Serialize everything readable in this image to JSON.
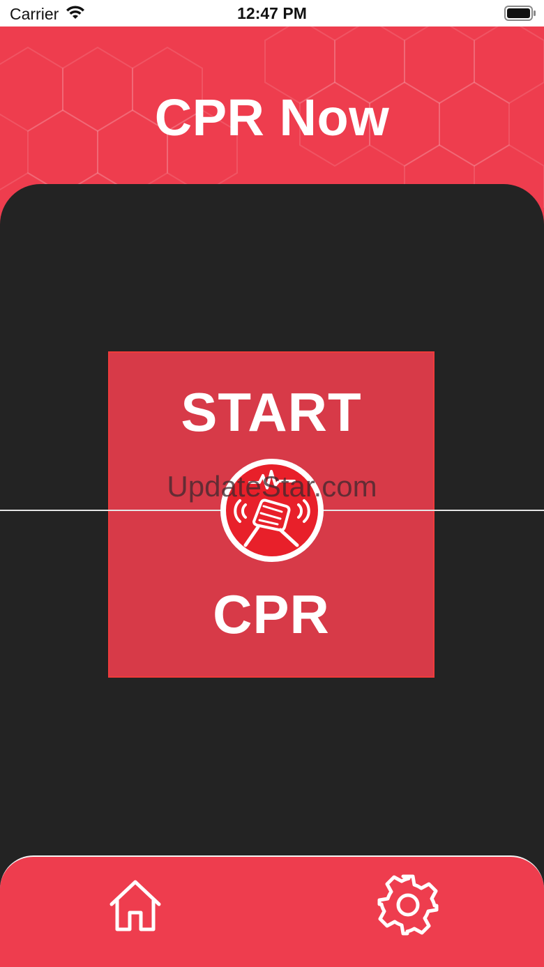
{
  "status_bar": {
    "carrier": "Carrier",
    "time": "12:47 PM",
    "icons": [
      "wifi-icon",
      "battery-icon"
    ]
  },
  "header": {
    "title": "CPR Now",
    "background_color": "#ee3d4e"
  },
  "main": {
    "background_color": "#232323",
    "start_button": {
      "top_label": "START",
      "bottom_label": "CPR",
      "color": "#d73a48",
      "logo_icon": "cpr-hands-icon"
    },
    "watermark": "UpdateStar.com"
  },
  "tab_bar": {
    "color": "#ee3d4e",
    "items": [
      {
        "name": "home",
        "icon": "home-icon"
      },
      {
        "name": "settings",
        "icon": "gear-icon"
      }
    ]
  }
}
